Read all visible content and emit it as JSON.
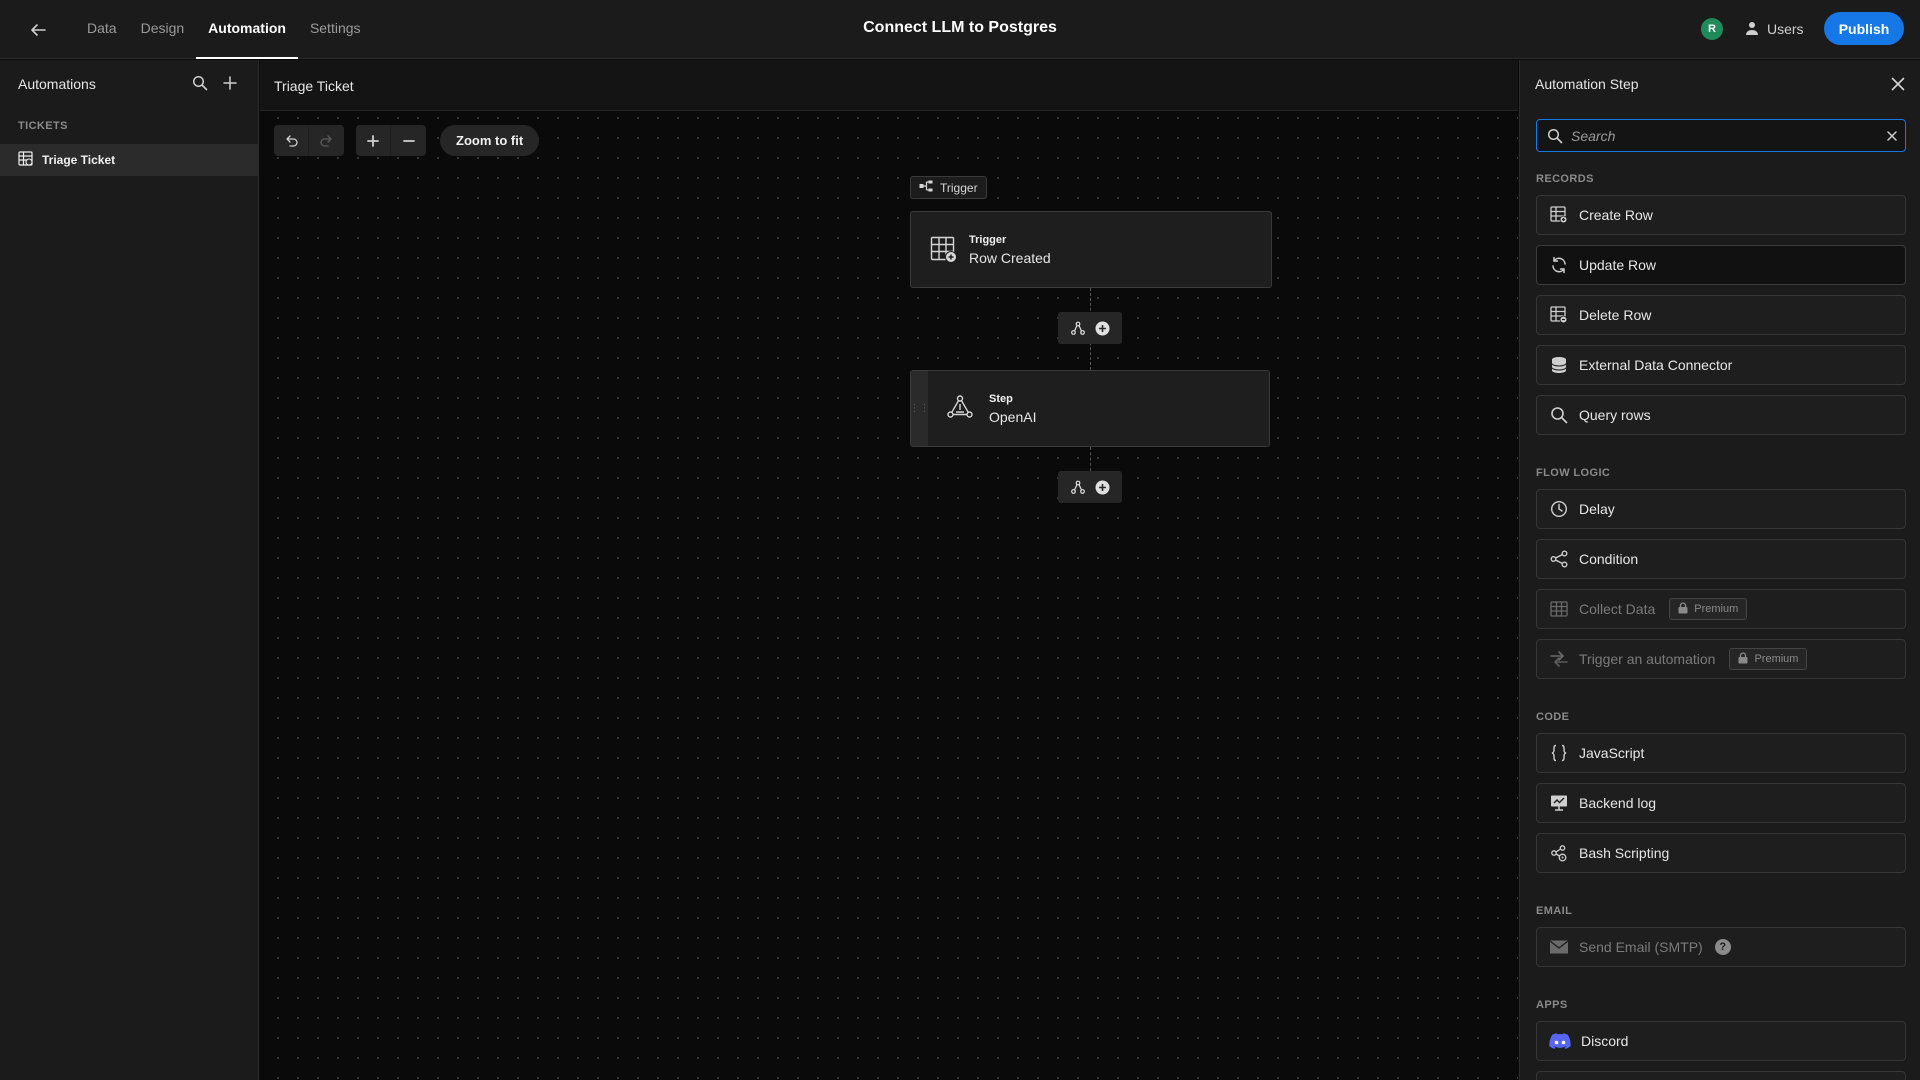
{
  "topbar": {
    "app_title": "Connect LLM to Postgres",
    "tabs": [
      {
        "label": "Data"
      },
      {
        "label": "Design"
      },
      {
        "label": "Automation",
        "active": true
      },
      {
        "label": "Settings"
      }
    ],
    "avatar_initial": "R",
    "users_label": "Users",
    "publish_label": "Publish"
  },
  "sidebar": {
    "header": "Automations",
    "section": "TICKETS",
    "items": [
      {
        "label": "Triage Ticket",
        "selected": true
      }
    ]
  },
  "canvas": {
    "title": "Triage Ticket",
    "zoom_fit_label": "Zoom to fit",
    "trigger_tag": "Trigger",
    "nodes": [
      {
        "type": "Trigger",
        "name": "Row Created",
        "icon": "table-add-icon"
      },
      {
        "type": "Step",
        "name": "OpenAI",
        "icon": "openai-icon"
      }
    ]
  },
  "panel": {
    "title": "Automation Step",
    "search_placeholder": "Search",
    "sections": [
      {
        "label": "RECORDS",
        "items": [
          {
            "label": "Create Row",
            "icon": "create-row-icon"
          },
          {
            "label": "Update Row",
            "icon": "refresh-icon",
            "highlight": true
          },
          {
            "label": "Delete Row",
            "icon": "delete-row-icon"
          },
          {
            "label": "External Data Connector",
            "icon": "database-icon"
          },
          {
            "label": "Query rows",
            "icon": "search-icon"
          }
        ]
      },
      {
        "label": "FLOW LOGIC",
        "items": [
          {
            "label": "Delay",
            "icon": "clock-icon"
          },
          {
            "label": "Condition",
            "icon": "branch-icon"
          },
          {
            "label": "Collect Data",
            "icon": "grid-icon",
            "disabled": true,
            "badge": "Premium"
          },
          {
            "label": "Trigger an automation",
            "icon": "swap-icon",
            "disabled": true,
            "badge": "Premium"
          }
        ]
      },
      {
        "label": "CODE",
        "items": [
          {
            "label": "JavaScript",
            "icon": "braces-icon"
          },
          {
            "label": "Backend log",
            "icon": "monitor-icon"
          },
          {
            "label": "Bash Scripting",
            "icon": "gears-icon"
          }
        ]
      },
      {
        "label": "EMAIL",
        "items": [
          {
            "label": "Send Email (SMTP)",
            "icon": "mail-icon",
            "disabled": true,
            "help": true
          }
        ]
      },
      {
        "label": "APPS",
        "items": [
          {
            "label": "Discord",
            "icon": "discord-icon"
          }
        ]
      }
    ]
  },
  "colors": {
    "accent": "#1677e6",
    "avatar": "#1f8a5a",
    "discord": "#5865f2"
  }
}
